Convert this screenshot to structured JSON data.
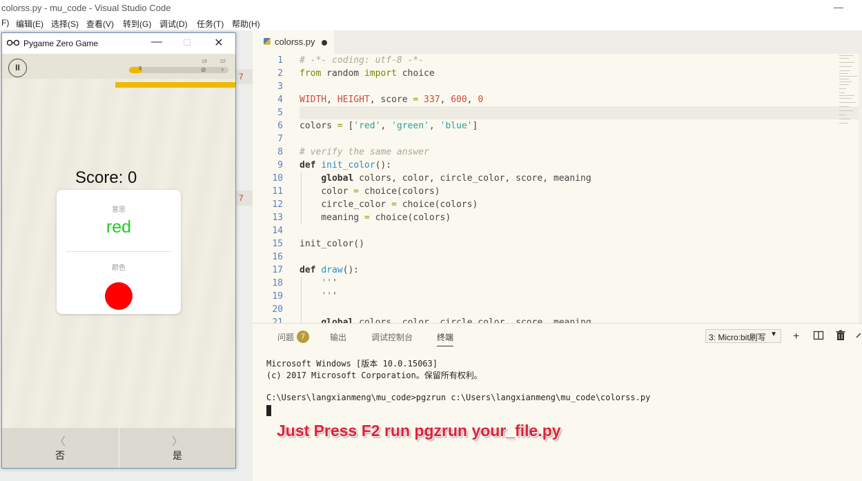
{
  "vscode": {
    "window_title": "colorss.py - mu_code - Visual Studio Code",
    "minimize": "—",
    "menu": [
      "F)",
      "编辑(E)",
      "选择(S)",
      "查看(V)",
      "转到(G)",
      "调试(D)",
      "任务(T)",
      "帮助(H)"
    ],
    "left_strip_markers": [
      "7",
      "7"
    ],
    "tab": {
      "name": "colorss.py",
      "modified": true
    },
    "code": [
      "# -*- coding: utf-8 -*-",
      "from random import choice",
      "",
      "WIDTH, HEIGHT, score = 337, 600, 0",
      "",
      "colors = ['red', 'green', 'blue']",
      "",
      "# verify the same answer",
      "def init_color():",
      "    global colors, color, circle_color, score, meaning",
      "    color = choice(colors)",
      "    circle_color = choice(colors)",
      "    meaning = choice(colors)",
      "",
      "init_color()",
      "",
      "def draw():",
      "    '''",
      "    '''",
      "",
      "    global colors, color, circle_color, score, meaning"
    ],
    "panel": {
      "tabs": [
        "问题",
        "输出",
        "调试控制台",
        "终端"
      ],
      "active_tab": "终端",
      "problems_count": "7",
      "terminal_selector": "3: Micro:bit刷写",
      "icons": [
        "plus-icon",
        "split-icon",
        "trash-icon",
        "chevron-up-icon"
      ],
      "terminal_lines": [
        "Microsoft Windows [版本 10.0.15063]",
        "(c) 2017 Microsoft Corporation。保留所有权利。",
        "",
        "C:\\Users\\langxianmeng\\mu_code>pgzrun c:\\Users\\langxianmeng\\mu_code\\colorss.py"
      ],
      "overlay_caption": "Just Press F2 run pgzrun your_file.py"
    }
  },
  "pygame": {
    "title": "Pygame Zero Game",
    "controls": {
      "minimize": "—",
      "maximize": "☐",
      "close": "✕"
    },
    "pause_symbol": "II",
    "progress": {
      "value": 3,
      "fraction": 0.13,
      "tick_a": "19",
      "tick_b": "22"
    },
    "score_text": "Score: 0",
    "card": {
      "meaning_label": "意思",
      "word": "red",
      "word_color": "#22cc22",
      "color_label": "颜色",
      "circle_color": "#ff0000"
    },
    "buttons": [
      {
        "arrow": "〈",
        "label": "否"
      },
      {
        "arrow": "〉",
        "label": "是"
      }
    ]
  }
}
